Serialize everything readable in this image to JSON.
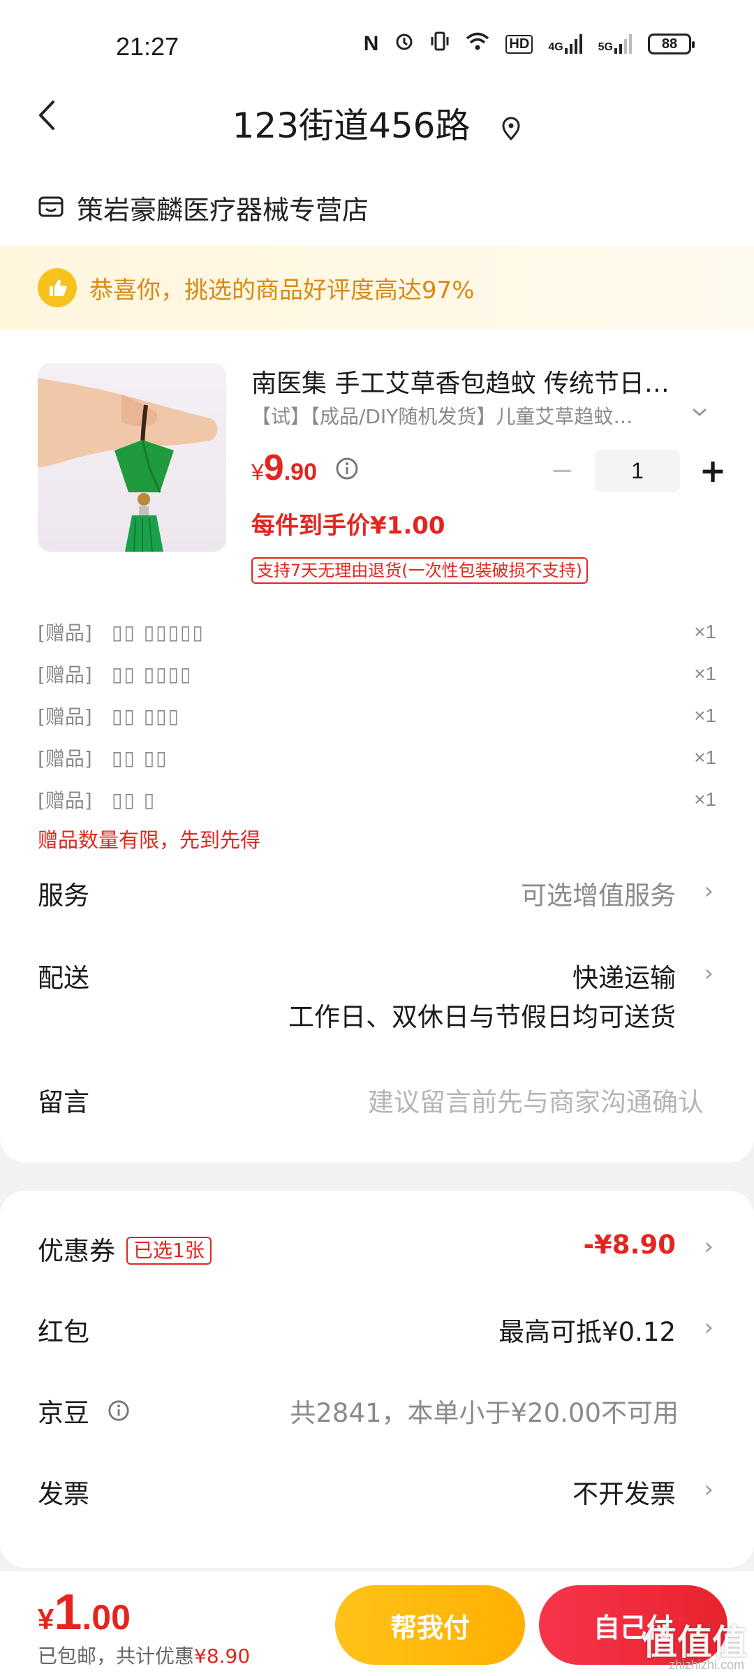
{
  "status_bar": {
    "time": "21:27",
    "nfc": "N",
    "alarm": "⏰",
    "vibrate": "📳",
    "hd": "HD",
    "net1": "4G",
    "net2": "5G",
    "battery": "88"
  },
  "header": {
    "back_icon": "‹",
    "title": "123街道456路"
  },
  "store": {
    "name": "策岩豪麟医疗器械专营店"
  },
  "banner": {
    "text": "恭喜你，挑选的商品好评度高达97%"
  },
  "product": {
    "title": "南医集 手工艾草香包趋蚊 传统节日…",
    "subtitle": "【试】【成品/DIY随机发货】儿童艾草趋蚊…",
    "price_currency": "¥",
    "price_int": "9",
    "price_dec": ".90",
    "quantity": "1",
    "minus_label": "−",
    "plus_label": "+",
    "unit_price": "每件到手价¥1.00",
    "return_policy": "支持7天无理由退货(一次性包装破损不支持)"
  },
  "gifts": [
    {
      "tag": "[赠品]",
      "name": "▯▯ ▯▯▯▯▯",
      "qty": "×1"
    },
    {
      "tag": "[赠品]",
      "name": "▯▯ ▯▯▯▯",
      "qty": "×1"
    },
    {
      "tag": "[赠品]",
      "name": "▯▯ ▯▯▯",
      "qty": "×1"
    },
    {
      "tag": "[赠品]",
      "name": "▯▯ ▯▯",
      "qty": "×1"
    },
    {
      "tag": "[赠品]",
      "name": "▯▯ ▯",
      "qty": "×1"
    }
  ],
  "gift_note": "赠品数量有限，先到先得",
  "rows": {
    "service_label": "服务",
    "service_value": "可选增值服务",
    "delivery_label": "配送",
    "delivery_value": "快递运输",
    "delivery_note": "工作日、双休日与节假日均可送货",
    "message_label": "留言",
    "message_placeholder": "建议留言前先与商家沟通确认"
  },
  "discounts": {
    "coupon_label": "优惠券",
    "coupon_badge": "已选1张",
    "coupon_value": "-¥8.90",
    "redpack_label": "红包",
    "redpack_value": "最高可抵¥0.12",
    "jd_label": "京豆",
    "jd_value": "共2841，本单小于¥20.00不可用",
    "invoice_label": "发票",
    "invoice_value": "不开发票"
  },
  "bottom": {
    "currency": "¥",
    "total_int": "1",
    "total_dec": ".00",
    "note_prefix": "已包邮，共计优惠",
    "note_amount": "¥8.90",
    "help_pay": "帮我付",
    "self_pay": "自己付",
    "watermark": "值值值",
    "watermark_url": "zhizhizhi.com"
  },
  "colors": {
    "accent_red": "#e4251e",
    "banner_text": "#d98a12",
    "help_button": "#ffb000"
  }
}
